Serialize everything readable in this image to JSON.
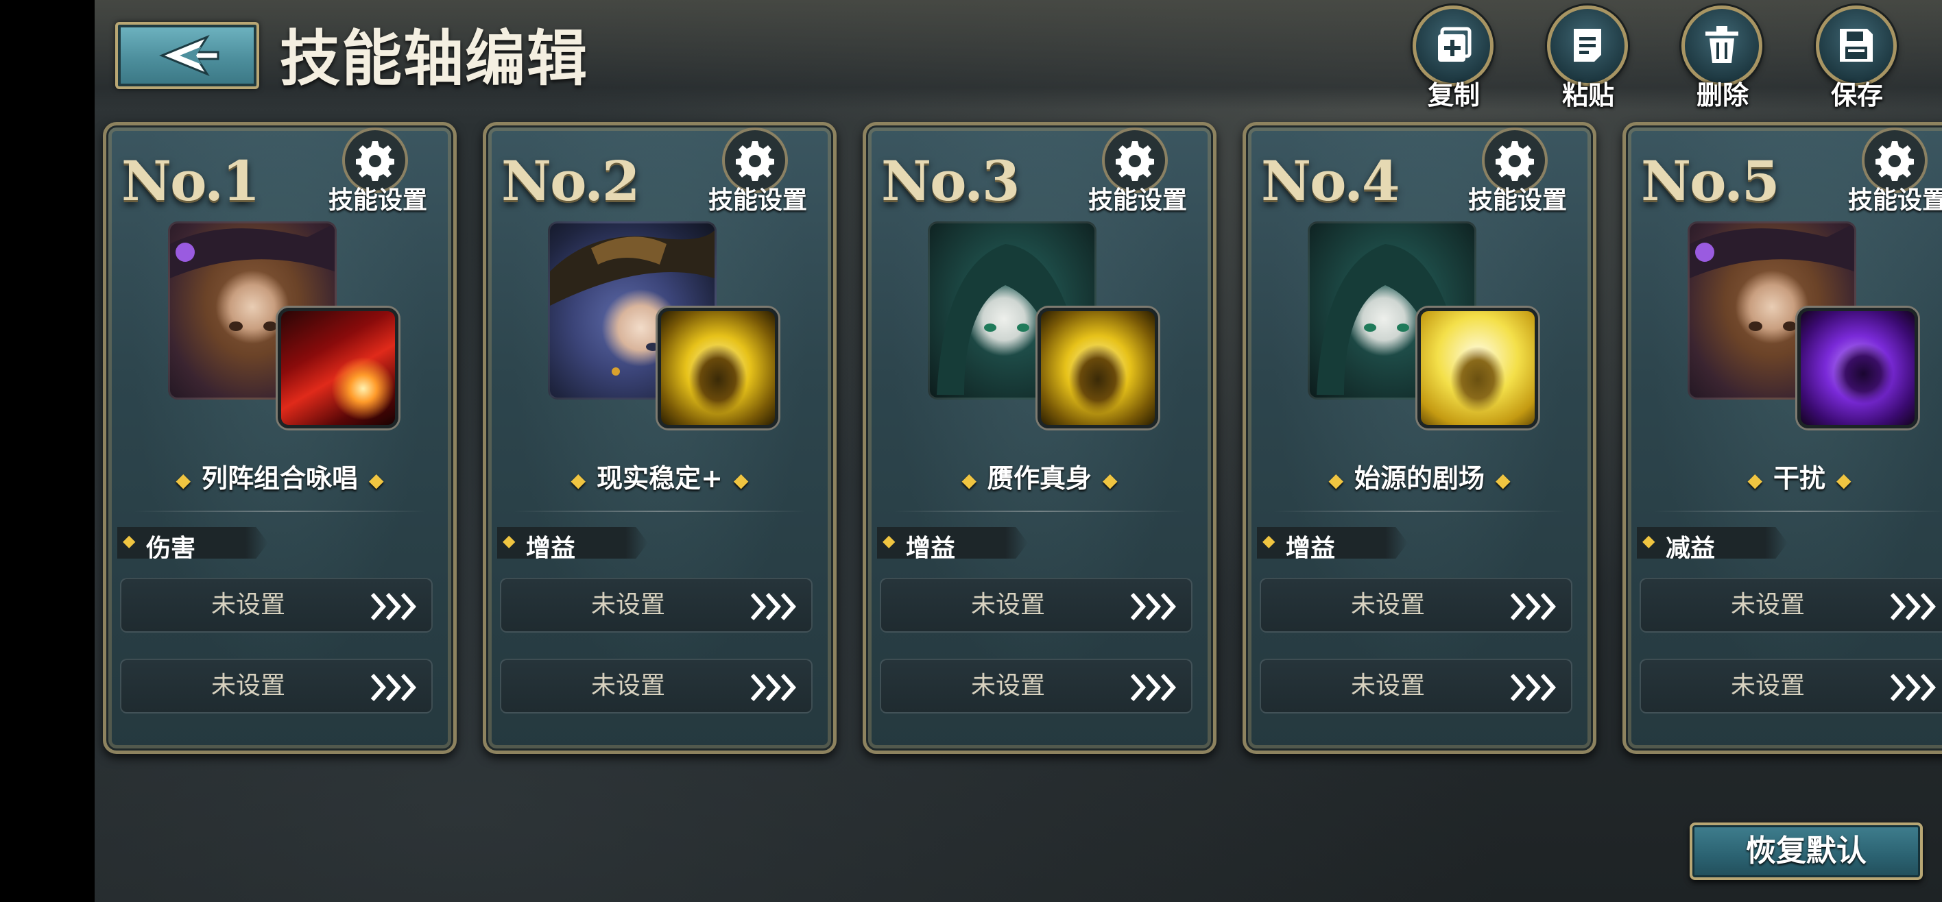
{
  "header": {
    "title": "技能轴编辑",
    "back_icon": "back-arrow-icon",
    "actions": [
      {
        "label": "复制",
        "icon": "copy-icon"
      },
      {
        "label": "粘贴",
        "icon": "paste-icon"
      },
      {
        "label": "删除",
        "icon": "trash-icon"
      },
      {
        "label": "保存",
        "icon": "save-icon"
      }
    ]
  },
  "cards": [
    {
      "number": "No.1",
      "settings_label": "技能设置",
      "skill_name": "列阵组合咏唱",
      "tag": "伤害",
      "slots": [
        "未设置",
        "未设置"
      ],
      "skill_color": "#e02a1a"
    },
    {
      "number": "No.2",
      "settings_label": "技能设置",
      "skill_name": "现实稳定+",
      "tag": "增益",
      "slots": [
        "未设置",
        "未设置"
      ],
      "skill_color": "#e7c21a"
    },
    {
      "number": "No.3",
      "settings_label": "技能设置",
      "skill_name": "赝作真身",
      "tag": "增益",
      "slots": [
        "未设置",
        "未设置"
      ],
      "skill_color": "#e7c21a"
    },
    {
      "number": "No.4",
      "settings_label": "技能设置",
      "skill_name": "始源的剧场",
      "tag": "增益",
      "slots": [
        "未设置",
        "未设置"
      ],
      "skill_color": "#f4e04a"
    },
    {
      "number": "No.5",
      "settings_label": "技能设置",
      "skill_name": "干扰",
      "tag": "减益",
      "slots": [
        "未设置",
        "未设置"
      ],
      "skill_color": "#7a2ad8"
    }
  ],
  "footer": {
    "restore_label": "恢复默认"
  },
  "colors": {
    "accent_gold": "#b9a774",
    "panel_teal": "#2d454d",
    "tag_diamond": "#f0c541"
  }
}
